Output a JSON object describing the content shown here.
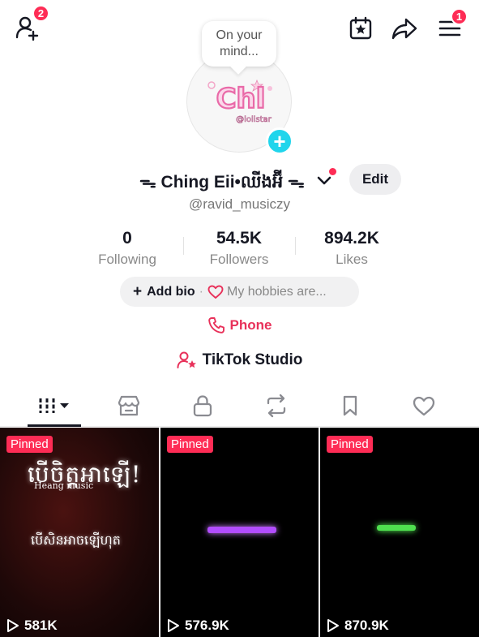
{
  "header": {
    "follow_badge": "2",
    "menu_badge": "1"
  },
  "avatar": {
    "bubble_text": "On your mind...",
    "logo_text": "Chl",
    "logo_handle": "@lolistar"
  },
  "profile": {
    "display_name": "ᯓ Ching Eii•ឈីងអ៊ី ᯓ",
    "edit_label": "Edit",
    "username": "@ravid_musiczy"
  },
  "stats": [
    {
      "value": "0",
      "label": "Following"
    },
    {
      "value": "54.5K",
      "label": "Followers"
    },
    {
      "value": "894.2K",
      "label": "Likes"
    }
  ],
  "bio": {
    "add_label": "Add bio",
    "separator": "·",
    "hobbies_text": "My hobbies are..."
  },
  "links": {
    "phone_label": "Phone",
    "studio_label": "TikTok Studio"
  },
  "videos": [
    {
      "pinned": "Pinned",
      "views": "581K",
      "title": "បើចិត្តអាឡើ!",
      "credit": "Heang music",
      "subtitle": "បើសិនអាចឡើហុត"
    },
    {
      "pinned": "Pinned",
      "views": "576.9K"
    },
    {
      "pinned": "Pinned",
      "views": "870.9K"
    }
  ],
  "colors": {
    "brand_red": "#fe2c55",
    "accent_cyan": "#20d5ec",
    "phone_red": "#e8315a"
  }
}
